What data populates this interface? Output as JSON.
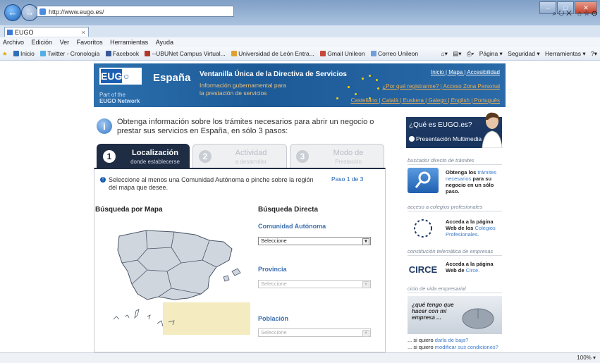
{
  "browser": {
    "address": "http://www.eugo.es/",
    "tab_title": "EUGO",
    "menu": [
      "Archivo",
      "Edición",
      "Ver",
      "Favoritos",
      "Herramientas",
      "Ayuda"
    ],
    "favorites": [
      {
        "label": "Inicio",
        "color": "#2f6fb8"
      },
      {
        "label": "Twitter - Cronología",
        "color": "#4fb0e8"
      },
      {
        "label": "Facebook",
        "color": "#3b5998"
      },
      {
        "label": "--UBUNet Campus Virtual...",
        "color": "#b2382c"
      },
      {
        "label": "Universidad de León Entra...",
        "color": "#e0a030"
      },
      {
        "label": "Gmail Unileon",
        "color": "#c8463a"
      },
      {
        "label": "Correo Unileon",
        "color": "#6fa0d8"
      }
    ],
    "commands": [
      "Página ▾",
      "Seguridad ▾",
      "Herramientas ▾"
    ],
    "status_zoom": "100% ▾"
  },
  "header": {
    "logo": "EUGO",
    "country": "España",
    "part_of": "Part of the",
    "network": "EUGO Network",
    "title": "Ventanilla Única de la Directiva de Servicios",
    "subtitle": "Información gubernamental para la prestación de servicios",
    "links_top": "Inicio | Mapa | Accesibilidad",
    "links_mid": "¿Por qué registrarme? | Acceso Zona Personal",
    "links_lang": "Castellano | Català | Euskera | Galego | English | Português"
  },
  "intro": "Obtenga información sobre los trámites necesarios para abrir un negocio o prestar sus servicios en España, en sólo 3 pasos:",
  "steps": [
    {
      "num": "1",
      "title": "Localización",
      "sub": "donde establecerse"
    },
    {
      "num": "2",
      "title": "Actividad",
      "sub": "a desarrollar"
    },
    {
      "num": "3",
      "title": "Modo de",
      "sub": "Prestación"
    }
  ],
  "content": {
    "instruction": "Seleccione al menos una Comunidad Autónoma o pinche sobre la región del mapa que desee.",
    "paso": "Paso 1 de 3",
    "map_heading": "Búsqueda por Mapa",
    "direct_heading": "Búsqueda Directa",
    "fields": [
      {
        "label": "Comunidad Autónoma",
        "value": "Seleccione"
      },
      {
        "label": "Provincia",
        "value": "Seleccione"
      },
      {
        "label": "Población",
        "value": "Seleccione"
      }
    ]
  },
  "sidebar": {
    "que_es": "¿Qué es EUGO.es?",
    "presentacion": "Presentación Multimedia",
    "sec1": "buscador directo de trámites",
    "txt1_a": "Obtenga los",
    "txt1_link": "trámites necesarios",
    "txt1_b": "para su negocio en un sólo paso.",
    "sec2": "acceso a colegios profesionales",
    "txt2_a": "Acceda a la página Web de los",
    "txt2_link": "Colegios Profesionales.",
    "sec3": "constitución telemática de empresas",
    "circe": "CIRCE",
    "txt3_a": "Acceda a la página Web de",
    "txt3_link": "Circe.",
    "sec4": "ciclo de vida empresarial",
    "banner": "¿qué tengo que hacer con mi empresa ...",
    "line1_a": "... si quiero",
    "line1_link": "darla de baja?",
    "line2_a": "... si quiero",
    "line2_link": "modificar sus condiciones?"
  }
}
